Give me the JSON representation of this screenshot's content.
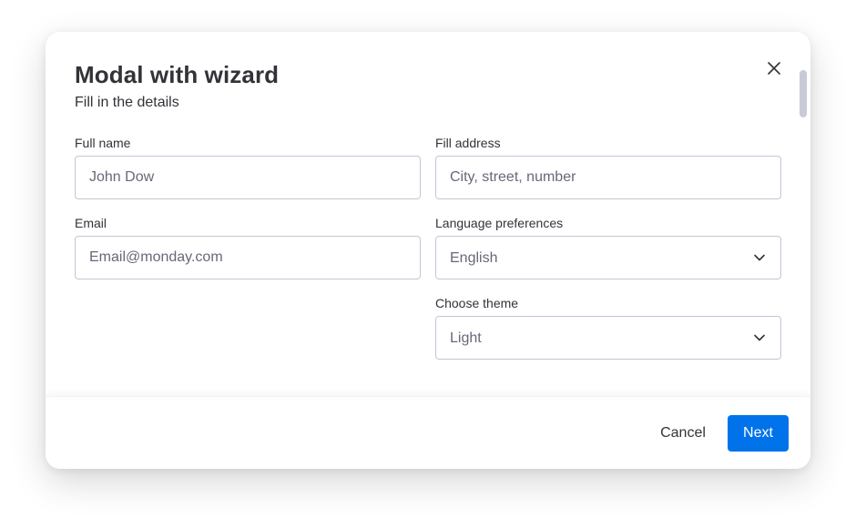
{
  "modal": {
    "title": "Modal with wizard",
    "subtitle": "Fill in the details"
  },
  "form": {
    "full_name": {
      "label": "Full name",
      "value": "",
      "placeholder": "John Dow"
    },
    "email": {
      "label": "Email",
      "value": "",
      "placeholder": "Email@monday.com"
    },
    "address": {
      "label": "Fill address",
      "value": "",
      "placeholder": "City, street, number"
    },
    "language": {
      "label": "Language preferences",
      "selected": "English"
    },
    "theme": {
      "label": "Choose theme",
      "selected": "Light"
    }
  },
  "footer": {
    "cancel_label": "Cancel",
    "next_label": "Next"
  },
  "icons": {
    "close": "close-icon",
    "chevron": "chevron-down-icon"
  },
  "colors": {
    "primary": "#0073ea",
    "text": "#323338",
    "placeholder": "#676879",
    "border": "#c3c6d4"
  }
}
